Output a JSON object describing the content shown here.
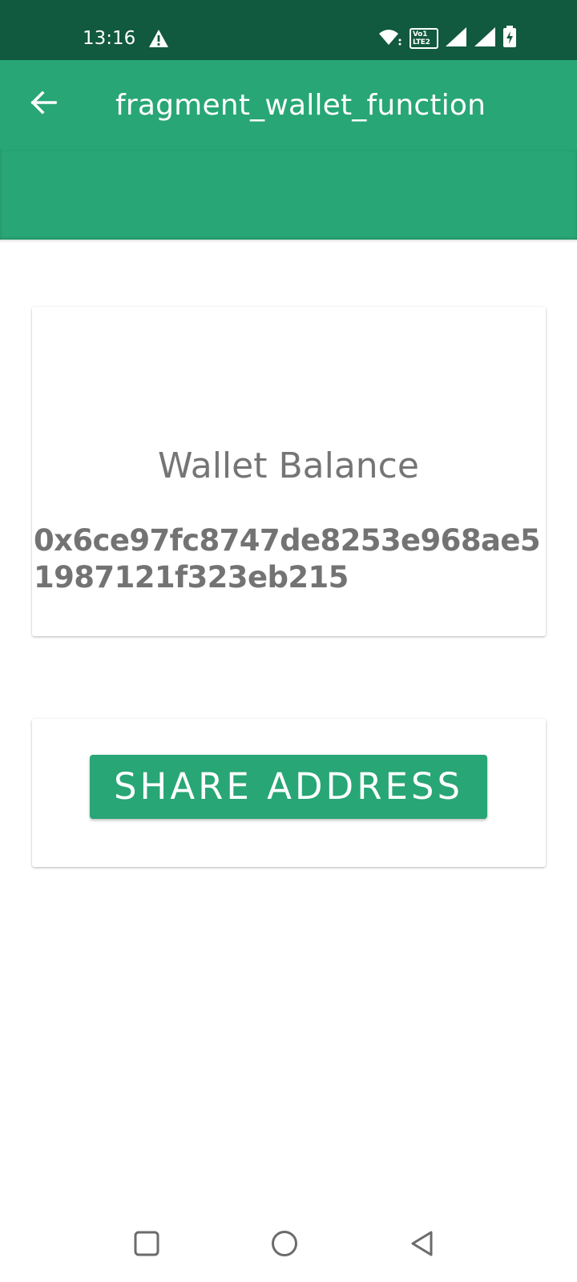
{
  "status_bar": {
    "time": "13:16",
    "lte_line1": "Vo",
    "lte_line2": "LTE",
    "sim1": "1",
    "sim2": "2",
    "icons": [
      "alert-icon",
      "wifi-icon",
      "volte-icon",
      "signal-icon",
      "signal-icon",
      "battery-charging-icon"
    ]
  },
  "app_bar": {
    "title": "fragment_wallet_function",
    "back_icon": "arrow-back-icon",
    "color": "#28a676"
  },
  "wallet": {
    "label": "Wallet Balance",
    "address": "0x6ce97fc8747de8253e968ae51987121f323eb215"
  },
  "actions": {
    "share_label": "SHARE ADDRESS"
  },
  "nav_bar": {
    "icons": [
      "recents-icon",
      "home-icon",
      "back-icon"
    ]
  }
}
